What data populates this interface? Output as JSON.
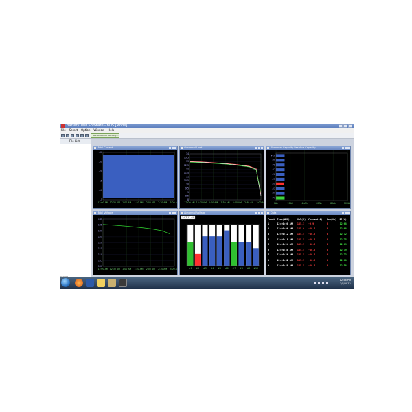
{
  "window": {
    "title": "Battery Test Software - BDS [Mode]"
  },
  "menu": [
    "File",
    "Select",
    "Option",
    "Window",
    "Help"
  ],
  "file_tab": "BL16000000U7BD3xxyZ.fpa5",
  "left_pane": {
    "header": "File List"
  },
  "panels": {
    "total_current": {
      "title": "Total Current",
      "x_ticks": [
        "12:00 AM",
        "12:30 AM",
        "1:00 AM",
        "1:30 AM",
        "2:00 AM",
        "2:30 AM",
        "3:00 AM"
      ],
      "y_ticks": [
        "-30",
        "-25",
        "-20",
        "-15",
        "-10",
        "-5"
      ]
    },
    "abnormal_load": {
      "title": "Abnormal Load",
      "x_ticks": [
        "12:00 AM",
        "12:30 AM",
        "1:00 AM",
        "1:30 AM",
        "2:00 AM",
        "2:30 AM",
        "3:00 AM"
      ],
      "y_ticks": [
        "14",
        "13.5",
        "13",
        "12.5",
        "12",
        "11.5",
        "11",
        "10.5",
        "10",
        "9.5",
        "9",
        "8.5",
        "8"
      ]
    },
    "abnormal_capacity": {
      "title": "Abnormal Capacity Residual Capacity",
      "x_ticks": [
        "0Ah",
        "20Ah",
        "40Ah",
        "60Ah",
        "80Ah",
        "100Ah"
      ],
      "y_ticks": [
        "#10",
        "#9",
        "#8",
        "#7",
        "#6",
        "#5",
        "#4",
        "#3",
        "#2",
        "#1"
      ]
    },
    "total_voltage": {
      "title": "Total Voltage",
      "x_ticks": [
        "12:00 AM",
        "12:30 AM",
        "1:00 AM",
        "1:30 AM",
        "2:00 AM",
        "2:30 AM",
        "3:00 AM"
      ],
      "y_ticks": [
        "140",
        "135",
        "130",
        "125",
        "120",
        "115",
        "110",
        "105",
        "100"
      ]
    },
    "abnormal_voltage": {
      "title": "Abnormal Voltage",
      "time_field": "1:07:11 AM",
      "x_ticks": [
        "#1",
        "#2",
        "#3",
        "#4",
        "#5",
        "#6",
        "#7",
        "#8",
        "#9",
        "#10"
      ]
    },
    "data": {
      "title": "Data",
      "columns": [
        "Count",
        "Time(HMS)",
        "Vol(V)",
        "Current(A)",
        "Cap(Ah)",
        "R1(V)"
      ],
      "rows": [
        [
          "1",
          "12:00:00 AM",
          "135.3",
          "-9.9",
          "0",
          "12.68"
        ],
        [
          "2",
          "12:00:06 AM",
          "135.6",
          "-30.5",
          "0",
          "12.68"
        ],
        [
          "3",
          "12:00:12 AM",
          "135.5",
          "-30.5",
          "0",
          "12.72"
        ],
        [
          "4",
          "12:00:18 AM",
          "135.5",
          "-30.5",
          "0",
          "12.75"
        ],
        [
          "5",
          "12:00:24 AM",
          "135.5",
          "-30.5",
          "0",
          "12.69"
        ],
        [
          "6",
          "12:00:30 AM",
          "135.5",
          "-30.5",
          "0",
          "12.79"
        ],
        [
          "7",
          "12:00:36 AM",
          "135.5",
          "-30.5",
          "0",
          "12.73"
        ],
        [
          "8",
          "12:00:42 AM",
          "135.5",
          "-30.5",
          "0",
          "12.68"
        ],
        [
          "9",
          "12:00:48 AM",
          "135.5",
          "-30.5",
          "0",
          "12.58"
        ]
      ]
    }
  },
  "taskbar": {
    "clock_time": "12:56 PM",
    "clock_date": "3/8/2012",
    "status_left": "UC1004"
  },
  "chart_data": [
    {
      "type": "area",
      "title": "Total Current",
      "x": [
        "12:00 AM",
        "12:30 AM",
        "1:00 AM",
        "1:30 AM",
        "2:00 AM",
        "2:30 AM",
        "3:00 AM"
      ],
      "series": [
        {
          "values": [
            -30,
            -30,
            -30,
            -30,
            -30,
            -30,
            -30
          ]
        }
      ],
      "ylim": [
        -30,
        0
      ],
      "color": "#3a5fc0"
    },
    {
      "type": "line",
      "title": "Abnormal Load",
      "x": [
        0,
        0.5,
        1,
        1.5,
        2,
        2.5,
        2.8,
        3
      ],
      "series": [
        {
          "values": [
            13.0,
            12.95,
            12.85,
            12.75,
            12.6,
            12.4,
            12.1,
            8.7
          ],
          "color": "#ff5050"
        },
        {
          "values": [
            12.95,
            12.9,
            12.8,
            12.7,
            12.55,
            12.35,
            12.0,
            8.5
          ],
          "color": "#ffffff"
        },
        {
          "values": [
            12.9,
            12.85,
            12.75,
            12.65,
            12.5,
            12.3,
            11.9,
            9.0
          ],
          "color": "#40c040"
        }
      ],
      "ylim": [
        8,
        14
      ]
    },
    {
      "type": "bar",
      "title": "Abnormal Capacity Residual Capacity",
      "categories": [
        "#1",
        "#2",
        "#3",
        "#4",
        "#5",
        "#6",
        "#7",
        "#8",
        "#9",
        "#10"
      ],
      "values": [
        12,
        12,
        12,
        11,
        12,
        12,
        12,
        12,
        12,
        12
      ],
      "colors": [
        "#3cd43c",
        "#3a5fc0",
        "#3a5fc0",
        "#ff3030",
        "#3a5fc0",
        "#3a5fc0",
        "#3a5fc0",
        "#3a5fc0",
        "#3a5fc0",
        "#3a5fc0"
      ],
      "xlim": [
        0,
        100
      ]
    },
    {
      "type": "line",
      "title": "Total Voltage",
      "x": [
        0,
        0.5,
        1,
        1.5,
        2,
        2.5,
        2.8
      ],
      "series": [
        {
          "values": [
            135.5,
            134.8,
            134.0,
            133.0,
            131.8,
            130.0,
            127.5
          ],
          "color": "#30d030"
        }
      ],
      "ylim": [
        100,
        140
      ]
    },
    {
      "type": "bar",
      "title": "Abnormal Voltage",
      "categories": [
        "#1",
        "#2",
        "#3",
        "#4",
        "#5",
        "#6",
        "#7",
        "#8",
        "#9",
        "#10"
      ],
      "values": [
        12.4,
        12.2,
        12.5,
        12.5,
        12.5,
        12.6,
        12.4,
        12.4,
        12.4,
        12.3
      ],
      "colors": [
        "#30c030",
        "#ff3030",
        "#3a5fc0",
        "#3a5fc0",
        "#3a5fc0",
        "#3a5fc0",
        "#30c030",
        "#3a5fc0",
        "#3a5fc0",
        "#3a5fc0"
      ],
      "background_color": "#ffffff"
    }
  ]
}
